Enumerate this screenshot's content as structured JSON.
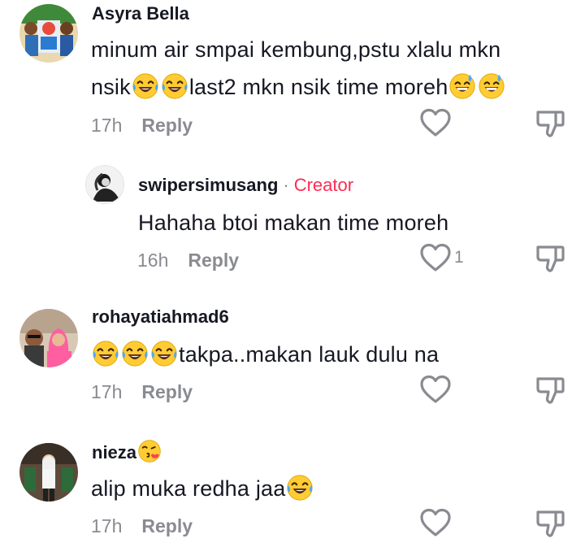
{
  "comments": [
    {
      "username": "Asyra Bella",
      "text_line1": "minum air smpai kembung,pstu xlalu mkn",
      "text_line2_a": "nsik",
      "text_line2_b": "last2 mkn nsik time moreh",
      "time": "17h",
      "reply_label": "Reply"
    },
    {
      "username": "swipersimusang",
      "creator_dot": "·",
      "creator_label": "Creator",
      "text": "Hahaha btoi makan time moreh",
      "time": "16h",
      "reply_label": "Reply",
      "like_count": "1"
    },
    {
      "username": "rohayatiahmad6",
      "text": "takpa..makan lauk dulu na",
      "time": "17h",
      "reply_label": "Reply"
    },
    {
      "username": "nieza",
      "text": "alip muka redha jaa",
      "time": "17h",
      "reply_label": "Reply"
    }
  ],
  "icons": {
    "like": "heart-outline-icon",
    "dislike": "thumbs-down-icon",
    "emoji_laugh": "face-with-tears-of-joy",
    "emoji_sweat": "grinning-face-with-sweat",
    "emoji_kiss": "face-blowing-a-kiss"
  },
  "colors": {
    "text": "#161823",
    "muted": "#8a8b91",
    "creator": "#fe2c55",
    "emoji_yellow": "#ffcc33"
  }
}
